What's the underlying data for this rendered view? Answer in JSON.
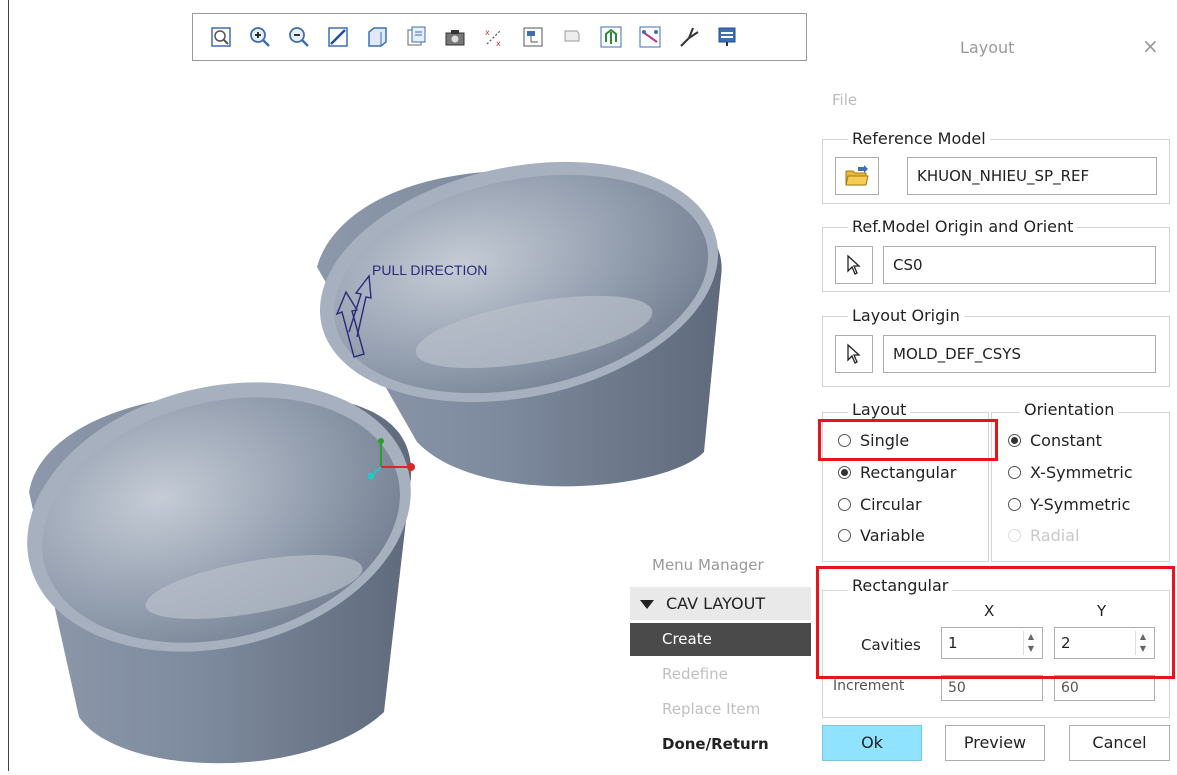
{
  "toolbar": {
    "icons": [
      "refit-icon",
      "zoom-in-icon",
      "zoom-out-icon",
      "repaint-icon",
      "saved-view-icon",
      "layer-icon",
      "screenshot-icon",
      "datum-display-icon",
      "model-tree-icon",
      "annotation-icon",
      "spin-center-icon",
      "pull-direction-icon",
      "csys-icon",
      "appearance-icon"
    ]
  },
  "viewport": {
    "annotation": "PULL DIRECTION"
  },
  "dialog": {
    "title": "Layout",
    "close": "×",
    "menu_file": "File",
    "reference_model": {
      "label": "Reference Model",
      "value": "KHUON_NHIEU_SP_REF"
    },
    "ref_origin": {
      "label": "Ref.Model Origin and Orient",
      "value": "CS0"
    },
    "layout_origin": {
      "label": "Layout Origin",
      "value": "MOLD_DEF_CSYS"
    },
    "layout_group": {
      "label": "Layout",
      "options": [
        {
          "label": "Single",
          "selected": false
        },
        {
          "label": "Rectangular",
          "selected": true
        },
        {
          "label": "Circular",
          "selected": false
        },
        {
          "label": "Variable",
          "selected": false
        }
      ]
    },
    "orientation_group": {
      "label": "Orientation",
      "options": [
        {
          "label": "Constant",
          "selected": true
        },
        {
          "label": "X-Symmetric",
          "selected": false
        },
        {
          "label": "Y-Symmetric",
          "selected": false
        },
        {
          "label": "Radial",
          "selected": false,
          "disabled": true
        }
      ]
    },
    "rectangular": {
      "label": "Rectangular",
      "col_x": "X",
      "col_y": "Y",
      "cavities_label": "Cavities",
      "cavities_x": "1",
      "cavities_y": "2",
      "increment_label": "Increment",
      "increment_x": "50",
      "increment_y": "60"
    },
    "buttons": {
      "ok": "Ok",
      "preview": "Preview",
      "cancel": "Cancel"
    }
  },
  "menu_manager": {
    "title": "Menu Manager",
    "header": "CAV LAYOUT",
    "items": [
      {
        "label": "Create",
        "state": "selected"
      },
      {
        "label": "Redefine",
        "state": "disabled"
      },
      {
        "label": "Replace Item",
        "state": "disabled"
      },
      {
        "label": "Done/Return",
        "state": "bold"
      }
    ]
  },
  "colors": {
    "highlight_box": "#e8141b",
    "ok_button": "#8fe3ff",
    "model": "#8793a6"
  }
}
